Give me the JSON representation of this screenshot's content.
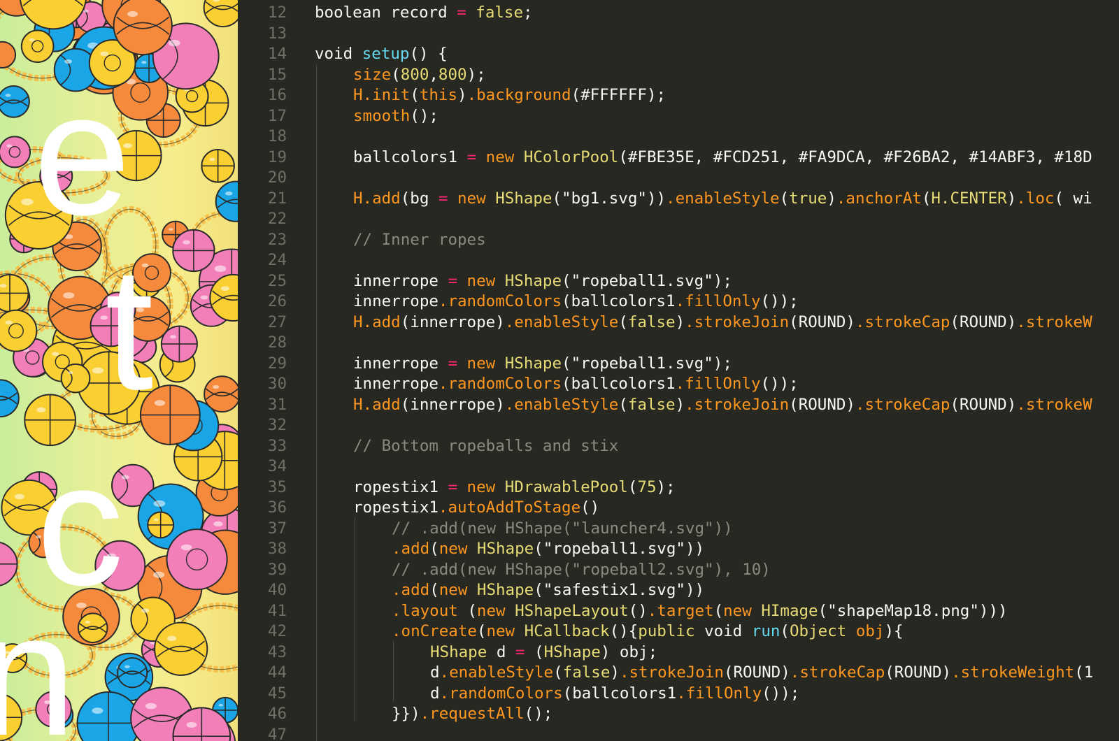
{
  "artwork": {
    "letters": [
      "e",
      "t",
      "c",
      "n"
    ],
    "colors": {
      "yellow": "#f9cf32",
      "pink": "#f37fb9",
      "blue": "#1aa6e6",
      "orange": "#f58a3c",
      "rope": "#f6c04a",
      "outline": "#2b2b2b",
      "bg_left": "#c9ee9b",
      "bg_right": "#f2e07a"
    }
  },
  "editor": {
    "theme": {
      "background": "#272822",
      "keyword": "#f92672",
      "type": "#66d9ef",
      "function": "#fd971f",
      "string": "#e6db74",
      "comment": "#8a8a80",
      "plain": "#f8f8f2",
      "line_number": "#6f6f68"
    },
    "lines": [
      {
        "num": "12",
        "indent": 0,
        "tokens": [
          [
            "boolean",
            "t-plain"
          ],
          [
            " record ",
            "t-plain"
          ],
          [
            "=",
            "t-op"
          ],
          [
            " false",
            "t-lit"
          ],
          [
            ";",
            "t-plain"
          ]
        ]
      },
      {
        "num": "13",
        "indent": 0,
        "tokens": []
      },
      {
        "num": "14",
        "indent": 0,
        "tokens": [
          [
            "void",
            "t-plain"
          ],
          [
            " ",
            "t-plain"
          ],
          [
            "setup",
            "t-type"
          ],
          [
            "() {",
            "t-plain"
          ]
        ]
      },
      {
        "num": "15",
        "indent": 1,
        "tokens": [
          [
            "size",
            "t-fn"
          ],
          [
            "(",
            "t-plain"
          ],
          [
            "800",
            "t-num"
          ],
          [
            ",",
            "t-plain"
          ],
          [
            "800",
            "t-num"
          ],
          [
            ");",
            "t-plain"
          ]
        ]
      },
      {
        "num": "16",
        "indent": 1,
        "tokens": [
          [
            "H.init",
            "t-fn"
          ],
          [
            "(",
            "t-plain"
          ],
          [
            "this",
            "t-fn"
          ],
          [
            ")",
            "t-plain"
          ],
          [
            ".background",
            "t-fn"
          ],
          [
            "(",
            "t-plain"
          ],
          [
            "#FFFFFF",
            "t-plain"
          ],
          [
            ");",
            "t-plain"
          ]
        ]
      },
      {
        "num": "17",
        "indent": 1,
        "tokens": [
          [
            "smooth",
            "t-fn"
          ],
          [
            "();",
            "t-plain"
          ]
        ]
      },
      {
        "num": "18",
        "indent": 0,
        "tokens": []
      },
      {
        "num": "19",
        "indent": 1,
        "tokens": [
          [
            "ballcolors1 ",
            "t-plain"
          ],
          [
            "=",
            "t-op"
          ],
          [
            " new",
            "t-fn"
          ],
          [
            " HColorPool",
            "t-obj"
          ],
          [
            "(#FBE35E, #FCD251, #FA9DCA, #F26BA2, #14ABF3, #18D",
            "t-plain"
          ]
        ]
      },
      {
        "num": "20",
        "indent": 0,
        "tokens": []
      },
      {
        "num": "21",
        "indent": 1,
        "tokens": [
          [
            "H.add",
            "t-fn"
          ],
          [
            "(bg ",
            "t-plain"
          ],
          [
            "=",
            "t-op"
          ],
          [
            " new",
            "t-fn"
          ],
          [
            " HShape",
            "t-obj"
          ],
          [
            "(\"bg1.svg\"))",
            "t-plain"
          ],
          [
            ".enableStyle",
            "t-fn"
          ],
          [
            "(",
            "t-plain"
          ],
          [
            "true",
            "t-lit"
          ],
          [
            ")",
            "t-plain"
          ],
          [
            ".anchorAt",
            "t-fn"
          ],
          [
            "(",
            "t-plain"
          ],
          [
            "H.CENTER",
            "t-obj"
          ],
          [
            ")",
            "t-plain"
          ],
          [
            ".loc",
            "t-fn"
          ],
          [
            "( wi",
            "t-plain"
          ]
        ]
      },
      {
        "num": "22",
        "indent": 0,
        "tokens": []
      },
      {
        "num": "23",
        "indent": 1,
        "tokens": [
          [
            "// Inner ropes",
            "t-com"
          ]
        ]
      },
      {
        "num": "24",
        "indent": 0,
        "tokens": []
      },
      {
        "num": "25",
        "indent": 1,
        "tokens": [
          [
            "innerrope ",
            "t-plain"
          ],
          [
            "=",
            "t-op"
          ],
          [
            " new",
            "t-fn"
          ],
          [
            " HShape",
            "t-obj"
          ],
          [
            "(\"ropeball1.svg\");",
            "t-plain"
          ]
        ]
      },
      {
        "num": "26",
        "indent": 1,
        "tokens": [
          [
            "innerrope",
            "t-plain"
          ],
          [
            ".randomColors",
            "t-fn"
          ],
          [
            "(ballcolors1",
            "t-plain"
          ],
          [
            ".fillOnly",
            "t-fn"
          ],
          [
            "());",
            "t-plain"
          ]
        ]
      },
      {
        "num": "27",
        "indent": 1,
        "tokens": [
          [
            "H.add",
            "t-fn"
          ],
          [
            "(innerrope)",
            "t-plain"
          ],
          [
            ".enableStyle",
            "t-fn"
          ],
          [
            "(",
            "t-plain"
          ],
          [
            "false",
            "t-lit"
          ],
          [
            ")",
            "t-plain"
          ],
          [
            ".strokeJoin",
            "t-fn"
          ],
          [
            "(ROUND)",
            "t-plain"
          ],
          [
            ".strokeCap",
            "t-fn"
          ],
          [
            "(ROUND)",
            "t-plain"
          ],
          [
            ".strokeW",
            "t-fn"
          ]
        ]
      },
      {
        "num": "28",
        "indent": 0,
        "tokens": []
      },
      {
        "num": "29",
        "indent": 1,
        "tokens": [
          [
            "innerrope ",
            "t-plain"
          ],
          [
            "=",
            "t-op"
          ],
          [
            " new",
            "t-fn"
          ],
          [
            " HShape",
            "t-obj"
          ],
          [
            "(\"ropeball1.svg\");",
            "t-plain"
          ]
        ]
      },
      {
        "num": "30",
        "indent": 1,
        "tokens": [
          [
            "innerrope",
            "t-plain"
          ],
          [
            ".randomColors",
            "t-fn"
          ],
          [
            "(ballcolors1",
            "t-plain"
          ],
          [
            ".fillOnly",
            "t-fn"
          ],
          [
            "());",
            "t-plain"
          ]
        ]
      },
      {
        "num": "31",
        "indent": 1,
        "tokens": [
          [
            "H.add",
            "t-fn"
          ],
          [
            "(innerrope)",
            "t-plain"
          ],
          [
            ".enableStyle",
            "t-fn"
          ],
          [
            "(",
            "t-plain"
          ],
          [
            "false",
            "t-lit"
          ],
          [
            ")",
            "t-plain"
          ],
          [
            ".strokeJoin",
            "t-fn"
          ],
          [
            "(ROUND)",
            "t-plain"
          ],
          [
            ".strokeCap",
            "t-fn"
          ],
          [
            "(ROUND)",
            "t-plain"
          ],
          [
            ".strokeW",
            "t-fn"
          ]
        ]
      },
      {
        "num": "32",
        "indent": 0,
        "tokens": []
      },
      {
        "num": "33",
        "indent": 1,
        "tokens": [
          [
            "// Bottom ropeballs and stix",
            "t-com"
          ]
        ]
      },
      {
        "num": "34",
        "indent": 0,
        "tokens": []
      },
      {
        "num": "35",
        "indent": 1,
        "tokens": [
          [
            "ropestix1 ",
            "t-plain"
          ],
          [
            "=",
            "t-op"
          ],
          [
            " new",
            "t-fn"
          ],
          [
            " HDrawablePool",
            "t-obj"
          ],
          [
            "(",
            "t-plain"
          ],
          [
            "75",
            "t-num"
          ],
          [
            ");",
            "t-plain"
          ]
        ]
      },
      {
        "num": "36",
        "indent": 1,
        "tokens": [
          [
            "ropestix1",
            "t-plain"
          ],
          [
            ".autoAddToStage",
            "t-fn"
          ],
          [
            "()",
            "t-plain"
          ]
        ]
      },
      {
        "num": "37",
        "indent": 2,
        "tokens": [
          [
            "// .add(new HShape(\"launcher4.svg\"))",
            "t-com"
          ]
        ]
      },
      {
        "num": "38",
        "indent": 2,
        "tokens": [
          [
            ".add",
            "t-fn"
          ],
          [
            "(",
            "t-plain"
          ],
          [
            "new",
            "t-fn"
          ],
          [
            " HShape",
            "t-obj"
          ],
          [
            "(\"ropeball1.svg\"))",
            "t-plain"
          ]
        ]
      },
      {
        "num": "39",
        "indent": 2,
        "tokens": [
          [
            "// .add(new HShape(\"ropeball2.svg\"), 10)",
            "t-com"
          ]
        ]
      },
      {
        "num": "40",
        "indent": 2,
        "tokens": [
          [
            ".add",
            "t-fn"
          ],
          [
            "(",
            "t-plain"
          ],
          [
            "new",
            "t-fn"
          ],
          [
            " HShape",
            "t-obj"
          ],
          [
            "(\"safestix1.svg\"))",
            "t-plain"
          ]
        ]
      },
      {
        "num": "41",
        "indent": 2,
        "tokens": [
          [
            ".layout",
            "t-fn"
          ],
          [
            " (",
            "t-plain"
          ],
          [
            "new",
            "t-fn"
          ],
          [
            " HShapeLayout",
            "t-obj"
          ],
          [
            "()",
            "t-plain"
          ],
          [
            ".target",
            "t-fn"
          ],
          [
            "(",
            "t-plain"
          ],
          [
            "new",
            "t-fn"
          ],
          [
            " HImage",
            "t-obj"
          ],
          [
            "(\"shapeMap18.png\")))",
            "t-plain"
          ]
        ]
      },
      {
        "num": "42",
        "indent": 2,
        "tokens": [
          [
            ".onCreate",
            "t-fn"
          ],
          [
            "(",
            "t-plain"
          ],
          [
            "new",
            "t-fn"
          ],
          [
            " HCallback",
            "t-obj"
          ],
          [
            "(){",
            "t-plain"
          ],
          [
            "public",
            "t-obj"
          ],
          [
            " void",
            "t-plain"
          ],
          [
            " run",
            "t-type"
          ],
          [
            "(",
            "t-plain"
          ],
          [
            "Object",
            "t-obj"
          ],
          [
            " obj",
            "t-fn"
          ],
          [
            "){",
            "t-plain"
          ]
        ]
      },
      {
        "num": "43",
        "indent": 3,
        "tokens": [
          [
            "HShape",
            "t-obj"
          ],
          [
            " d ",
            "t-plain"
          ],
          [
            "=",
            "t-op"
          ],
          [
            " (",
            "t-plain"
          ],
          [
            "HShape",
            "t-obj"
          ],
          [
            ") obj;",
            "t-plain"
          ]
        ]
      },
      {
        "num": "44",
        "indent": 3,
        "tokens": [
          [
            "d",
            "t-plain"
          ],
          [
            ".enableStyle",
            "t-fn"
          ],
          [
            "(",
            "t-plain"
          ],
          [
            "false",
            "t-lit"
          ],
          [
            ")",
            "t-plain"
          ],
          [
            ".strokeJoin",
            "t-fn"
          ],
          [
            "(ROUND)",
            "t-plain"
          ],
          [
            ".strokeCap",
            "t-fn"
          ],
          [
            "(ROUND)",
            "t-plain"
          ],
          [
            ".strokeWeight",
            "t-fn"
          ],
          [
            "(1",
            "t-plain"
          ]
        ]
      },
      {
        "num": "45",
        "indent": 3,
        "tokens": [
          [
            "d",
            "t-plain"
          ],
          [
            ".randomColors",
            "t-fn"
          ],
          [
            "(ballcolors1",
            "t-plain"
          ],
          [
            ".fillOnly",
            "t-fn"
          ],
          [
            "());",
            "t-plain"
          ]
        ]
      },
      {
        "num": "46",
        "indent": 2,
        "tokens": [
          [
            "}})",
            "t-plain"
          ],
          [
            ".requestAll",
            "t-fn"
          ],
          [
            "();",
            "t-plain"
          ]
        ]
      },
      {
        "num": "47",
        "indent": 0,
        "tokens": []
      }
    ]
  }
}
